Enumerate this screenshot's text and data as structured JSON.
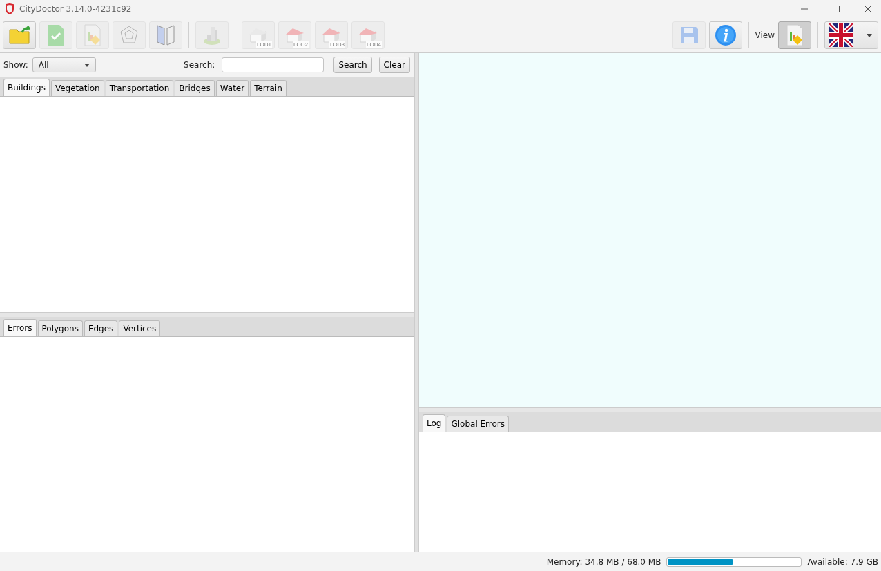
{
  "window": {
    "title": "CityDoctor 3.14.0-4231c92"
  },
  "toolbar": [
    {
      "kind": "open",
      "disabled": false
    },
    {
      "kind": "check",
      "disabled": true
    },
    {
      "kind": "report",
      "disabled": true
    },
    {
      "kind": "solid",
      "disabled": true
    },
    {
      "kind": "planes",
      "disabled": true
    },
    {
      "kind": "separator"
    },
    {
      "kind": "city",
      "disabled": true
    },
    {
      "kind": "separator"
    },
    {
      "kind": "lod",
      "disabled": true,
      "label": "LOD1"
    },
    {
      "kind": "lod",
      "disabled": true,
      "label": "LOD2"
    },
    {
      "kind": "lod",
      "disabled": true,
      "label": "LOD3"
    },
    {
      "kind": "lod",
      "disabled": true,
      "label": "LOD4"
    }
  ],
  "toolbar_right": {
    "save_disabled": true,
    "view_label": "View",
    "view_selected": true
  },
  "filter": {
    "show_label": "Show:",
    "show_value": "All",
    "search_label": "Search:",
    "buttons": [
      "Search",
      "Clear"
    ]
  },
  "feature_tabs": [
    {
      "label": "Buildings",
      "selected": true
    },
    {
      "label": "Vegetation",
      "selected": false
    },
    {
      "label": "Transportation",
      "selected": false
    },
    {
      "label": "Bridges",
      "selected": false
    },
    {
      "label": "Water",
      "selected": false
    },
    {
      "label": "Terrain",
      "selected": false
    }
  ],
  "detail_tabs": [
    {
      "label": "Errors",
      "selected": true
    },
    {
      "label": "Polygons",
      "selected": false
    },
    {
      "label": "Edges",
      "selected": false
    },
    {
      "label": "Vertices",
      "selected": false
    }
  ],
  "log_tabs": [
    {
      "label": "Log",
      "selected": true
    },
    {
      "label": "Global Errors",
      "selected": false
    }
  ],
  "status_bar": {
    "memory": "Memory: 34.8 MB / 68.0 MB",
    "level": 0.49,
    "available": "Available: 7.9 GB"
  }
}
